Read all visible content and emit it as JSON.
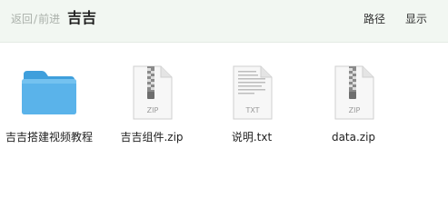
{
  "header": {
    "back_label": "返回",
    "separator": "/",
    "forward_label": "前进",
    "title": "吉吉",
    "path_label": "路径",
    "show_label": "显示"
  },
  "files": [
    {
      "name": "吉吉搭建视频教程",
      "type": "folder",
      "icon": "folder-icon"
    },
    {
      "name": "吉吉组件.zip",
      "type": "zip",
      "badge": "ZIP",
      "icon": "zip-file-icon"
    },
    {
      "name": "说明.txt",
      "type": "txt",
      "badge": "TXT",
      "icon": "text-file-icon"
    },
    {
      "name": "data.zip",
      "type": "zip",
      "badge": "ZIP",
      "icon": "zip-file-icon"
    }
  ],
  "colors": {
    "header_bg": "#f2f7f2",
    "folder_blue": "#5ab3ea"
  }
}
